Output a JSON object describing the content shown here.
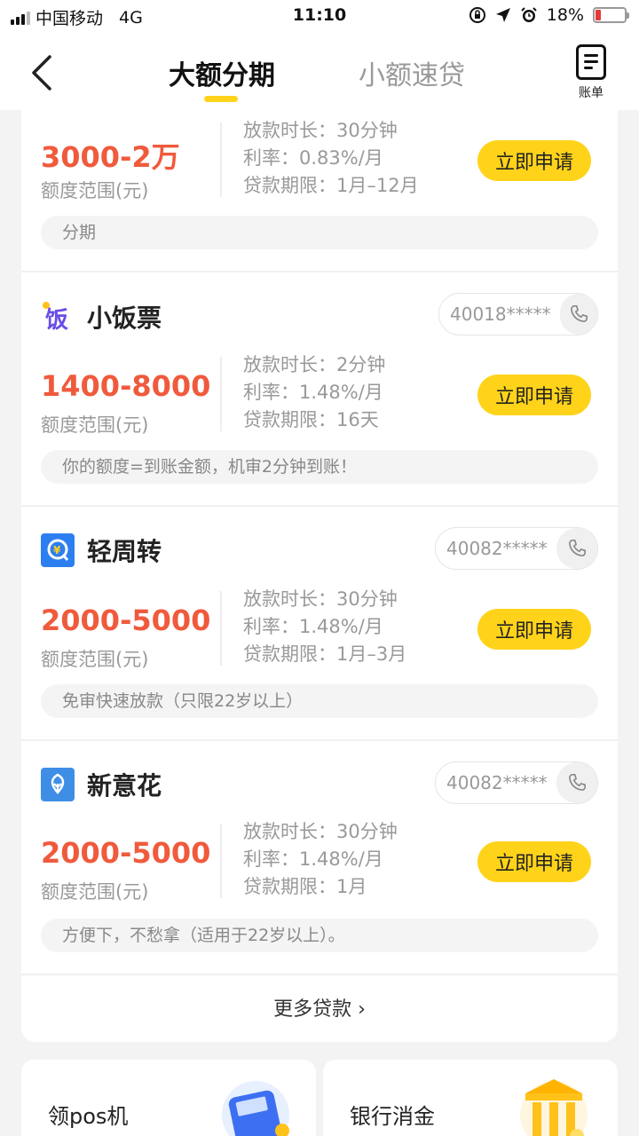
{
  "status_bar": {
    "carrier": "中国移动",
    "network": "4G",
    "time": "11:10",
    "battery": "18%",
    "battery_level": 0.18
  },
  "nav": {
    "tabs": [
      {
        "label": "大额分期",
        "active": true
      },
      {
        "label": "小额速贷",
        "active": false
      }
    ],
    "bill_label": "账单"
  },
  "labels": {
    "range_label": "额度范围(元)",
    "apply": "立即申请"
  },
  "loans": [
    {
      "name": "",
      "phone": "",
      "amount": "3000-2万",
      "details": [
        "放款时长：30分钟",
        "利率：0.83%/月",
        "贷款期限：1月–12月"
      ],
      "tag": "分期"
    },
    {
      "name": "小饭票",
      "logo_icon": "fan-icon",
      "logo_color": "#6b4de6",
      "phone": "40018*****",
      "amount": "1400-8000",
      "details": [
        "放款时长：2分钟",
        "利率：1.48%/月",
        "贷款期限：16天"
      ],
      "tag": "你的额度=到账金额，机审2分钟到账！"
    },
    {
      "name": "轻周转",
      "logo_icon": "yen-q-icon",
      "logo_color": "#2d7ff0",
      "phone": "40082*****",
      "amount": "2000-5000",
      "details": [
        "放款时长：30分钟",
        "利率：1.48%/月",
        "贷款期限：1月–3月"
      ],
      "tag": "免审快速放款（只限22岁以上）"
    },
    {
      "name": "新意花",
      "logo_icon": "flower-icon",
      "logo_color": "#3e8ee6",
      "phone": "40082*****",
      "amount": "2000-5000",
      "details": [
        "放款时长：30分钟",
        "利率：1.48%/月",
        "贷款期限：1月"
      ],
      "tag": "方便下，不愁拿（适用于22岁以上）。"
    }
  ],
  "more_loans": "更多贷款 ›",
  "tiles": [
    {
      "label": "领pos机",
      "icon": "pos-machine-icon"
    },
    {
      "label": "银行消金",
      "icon": "bank-icon"
    }
  ],
  "colors": {
    "accent": "#ffd31a",
    "amount": "#f05a3c"
  }
}
